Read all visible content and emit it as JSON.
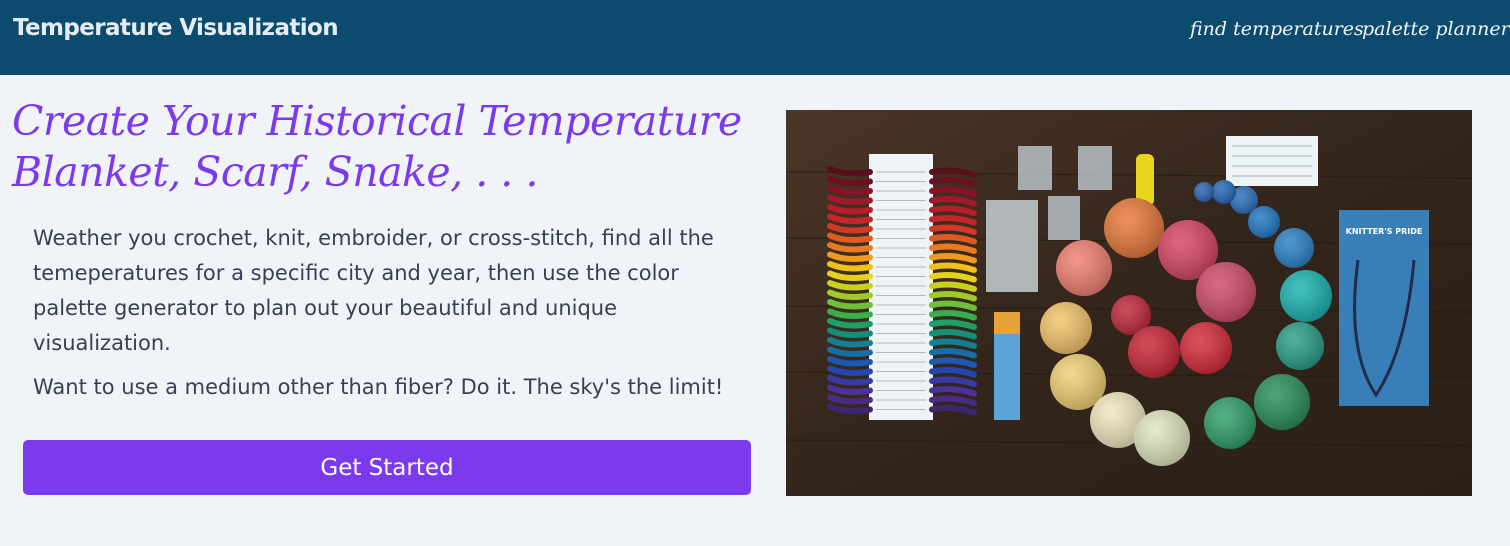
{
  "nav": {
    "brand": "Temperature Visualization",
    "links": [
      "find temperatures",
      "palette planner"
    ]
  },
  "hero": {
    "heading": "Create Your Historical Temperature Blanket, Scarf, Snake, . . .",
    "paragraphs": [
      "Weather you crochet, knit, embroider, or cross-stitch, find all the temeperatures for a specific city and year, then use the color palette generator to plan out your beautiful and unique visualization.",
      "Want to use a medium other than fiber? Do it. The sky's the limit!"
    ],
    "cta_label": "Get Started"
  },
  "photo": {
    "alt": "yarn balls on wooden table",
    "needles_brand": "KNITTER'S PRIDE",
    "colors": {
      "wood": "#3b2c22",
      "accent": "#7c3aed",
      "navbar": "#0c4a6e"
    }
  }
}
